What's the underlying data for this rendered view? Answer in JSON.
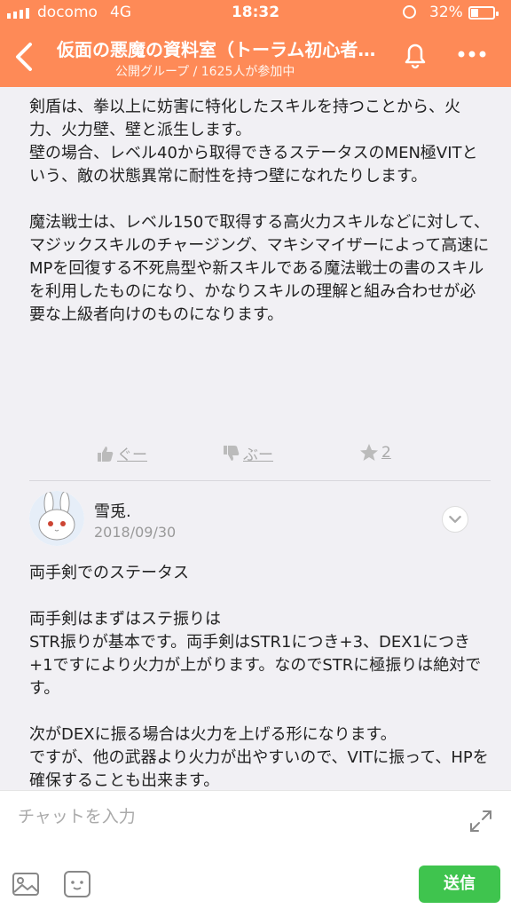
{
  "status_bar": {
    "carrier": "docomo",
    "network": "4G",
    "time": "18:32",
    "battery": "32%",
    "battery_level": 0.32
  },
  "header": {
    "title": "仮面の悪魔の資料室（トーラム初心者…",
    "subtitle": "公開グループ / 1625人が参加中",
    "icons": [
      "back-icon",
      "bell-icon",
      "more-icon"
    ]
  },
  "post1": {
    "body": "剣盾は、拳以上に妨害に特化したスキルを持つことから、火力、火力壁、壁と派生します。\n壁の場合、レベル40から取得できるステータスのMEN極VITという、敵の状態異常に耐性を持つ壁になれたりします。\n\n魔法戦士は、レベル150で取得する高火力スキルなどに対して、マジックスキルのチャージング、マキシマイザーによって高速にMPを回復する不死鳥型や新スキルである魔法戦士の書のスキルを利用したものになり、かなりスキルの理解と組み合わせが必要な上級者向けのものになります。",
    "actions": {
      "good_label": "ぐー",
      "bad_label": "ぶー",
      "star_count": "2"
    }
  },
  "post2": {
    "author": "雪兎.",
    "date": "2018/09/30",
    "body": "両手剣でのステータス\n\n両手剣はまずはステ振りは\nSTR振りが基本です。両手剣はSTR1につき+3、DEX1につき+1ですにより火力が上がります。なのでSTRに極振りは絶対です。\n\n次がDEXに振る場合は火力を上げる形になります。\nですが、他の武器より火力が出やすいので、VITに振って、HPを確保することも出来ます。"
  },
  "composer": {
    "placeholder": "チャットを入力",
    "send_label": "送信"
  },
  "colors": {
    "header": "#fe8a57",
    "send": "#3fc44e",
    "background": "#f1f0f4"
  }
}
